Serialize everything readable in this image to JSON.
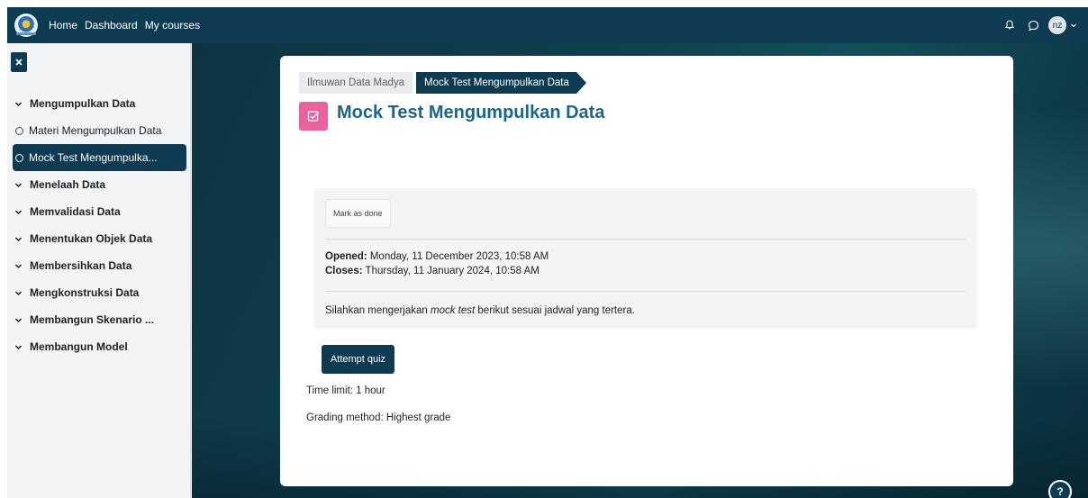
{
  "navbar": {
    "links": [
      "Home",
      "Dashboard",
      "My courses"
    ],
    "avatar_initials": "nz",
    "icons": [
      "bell-icon",
      "chat-bubble-icon",
      "chevron-down-icon"
    ]
  },
  "sidebar": {
    "items": [
      {
        "type": "section",
        "label": "Mengumpulkan Data"
      },
      {
        "type": "activity",
        "label": "Materi Mengumpulkan Data"
      },
      {
        "type": "activity",
        "label": "Mock Test Mengumpulka...",
        "active": true
      },
      {
        "type": "section",
        "label": "Menelaah Data"
      },
      {
        "type": "section",
        "label": "Memvalidasi Data"
      },
      {
        "type": "section",
        "label": "Menentukan Objek Data"
      },
      {
        "type": "section",
        "label": "Membersihkan Data"
      },
      {
        "type": "section",
        "label": "Mengkonstruksi Data"
      },
      {
        "type": "section",
        "label": "Membangun Skenario ..."
      },
      {
        "type": "section",
        "label": "Membangun Model"
      }
    ]
  },
  "breadcrumb": [
    "Ilmuwan Data Madya",
    "Mock Test Mengumpulkan Data"
  ],
  "page": {
    "title": "Mock Test Mengumpulkan Data",
    "mark_as_done": "Mark as done",
    "opened_label": "Opened:",
    "opened_value": "Monday, 11 December 2023, 10:58 AM",
    "closes_label": "Closes:",
    "closes_value": "Thursday, 11 January 2024, 10:58 AM",
    "instruction_before": "Silahkan mengerjakan ",
    "instruction_em": "mock test",
    "instruction_after": " berikut sesuai jadwal yang tertera.",
    "attempt_button": "Attempt quiz",
    "time_limit": "Time limit: 1 hour",
    "grading_method": "Grading method: Highest grade"
  },
  "help_button": "?",
  "colors": {
    "navbar": "#0e3a52",
    "accent": "#0e3a52",
    "title": "#1b6686",
    "quiz_icon": "#e9629f"
  }
}
